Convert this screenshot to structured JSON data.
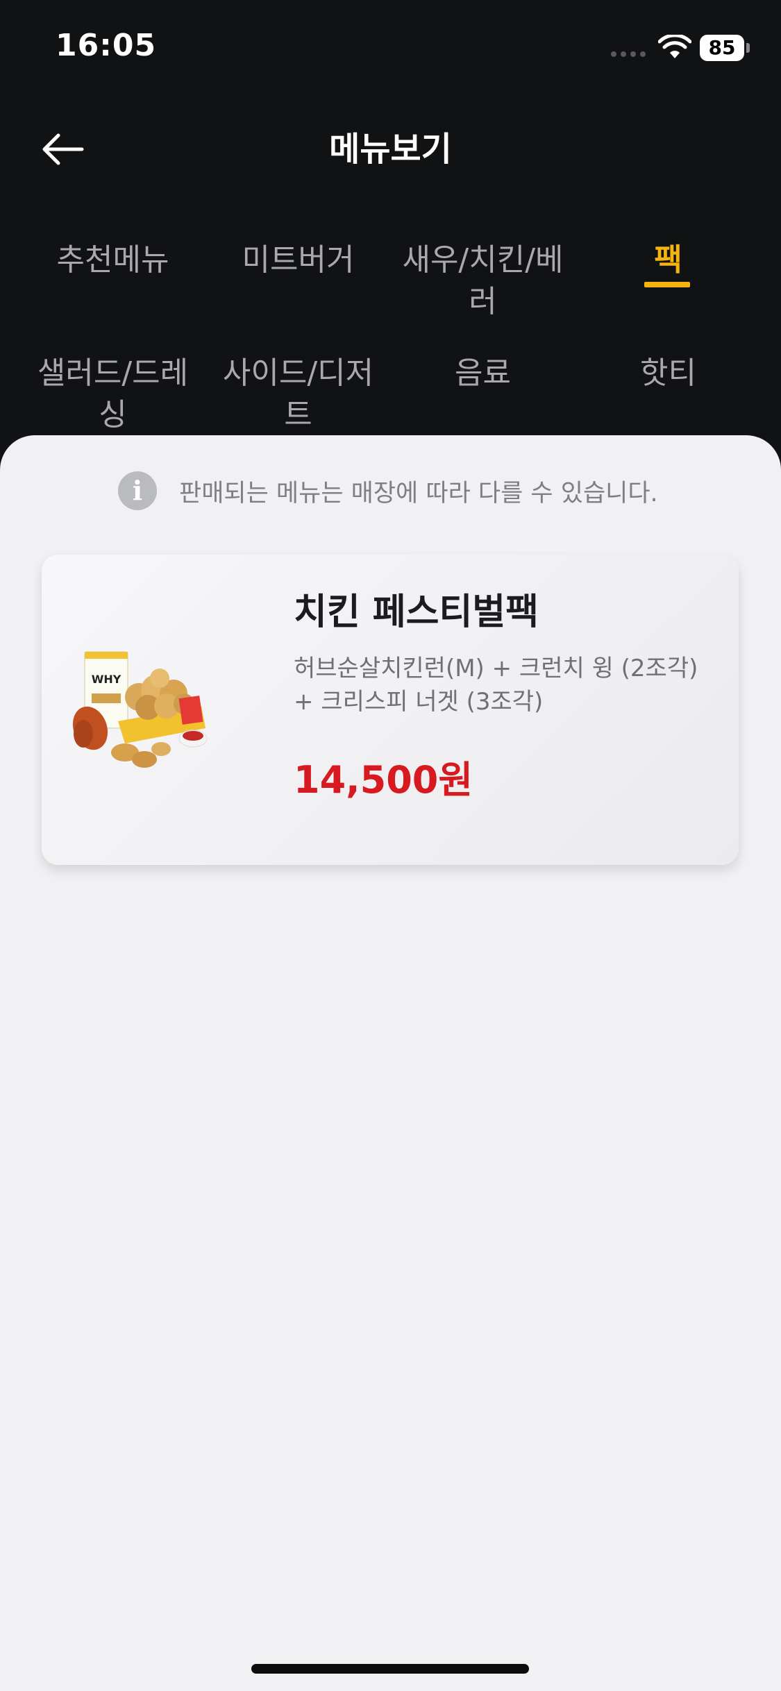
{
  "status_bar": {
    "time": "16:05",
    "battery": "85"
  },
  "header": {
    "title": "메뉴보기"
  },
  "tabs": [
    {
      "label": "추천메뉴"
    },
    {
      "label": "미트버거"
    },
    {
      "label": "새우/치킨/베\n러"
    },
    {
      "label": "팩"
    },
    {
      "label": "샐러드/드레\n싱"
    },
    {
      "label": "사이드/디저\n트"
    },
    {
      "label": "음료"
    },
    {
      "label": "핫티"
    }
  ],
  "active_tab": "팩",
  "notice": {
    "text": "판매되는 메뉴는 매장에 따라 다를 수 있습니다."
  },
  "menu_items": [
    {
      "name": "치킨 페스티벌팩",
      "description": "허브순살치킨런(M) + 크런치 윙 (2조각)\n+ 크리스피 너겟 (3조각)",
      "price": "14,500원",
      "image_icon": "chicken-pack-image",
      "image_text": "WHY"
    }
  ],
  "colors": {
    "accent": "#f6b40e",
    "price": "#d71920",
    "background_dark": "#111214",
    "sheet": "#f1f1f3"
  }
}
